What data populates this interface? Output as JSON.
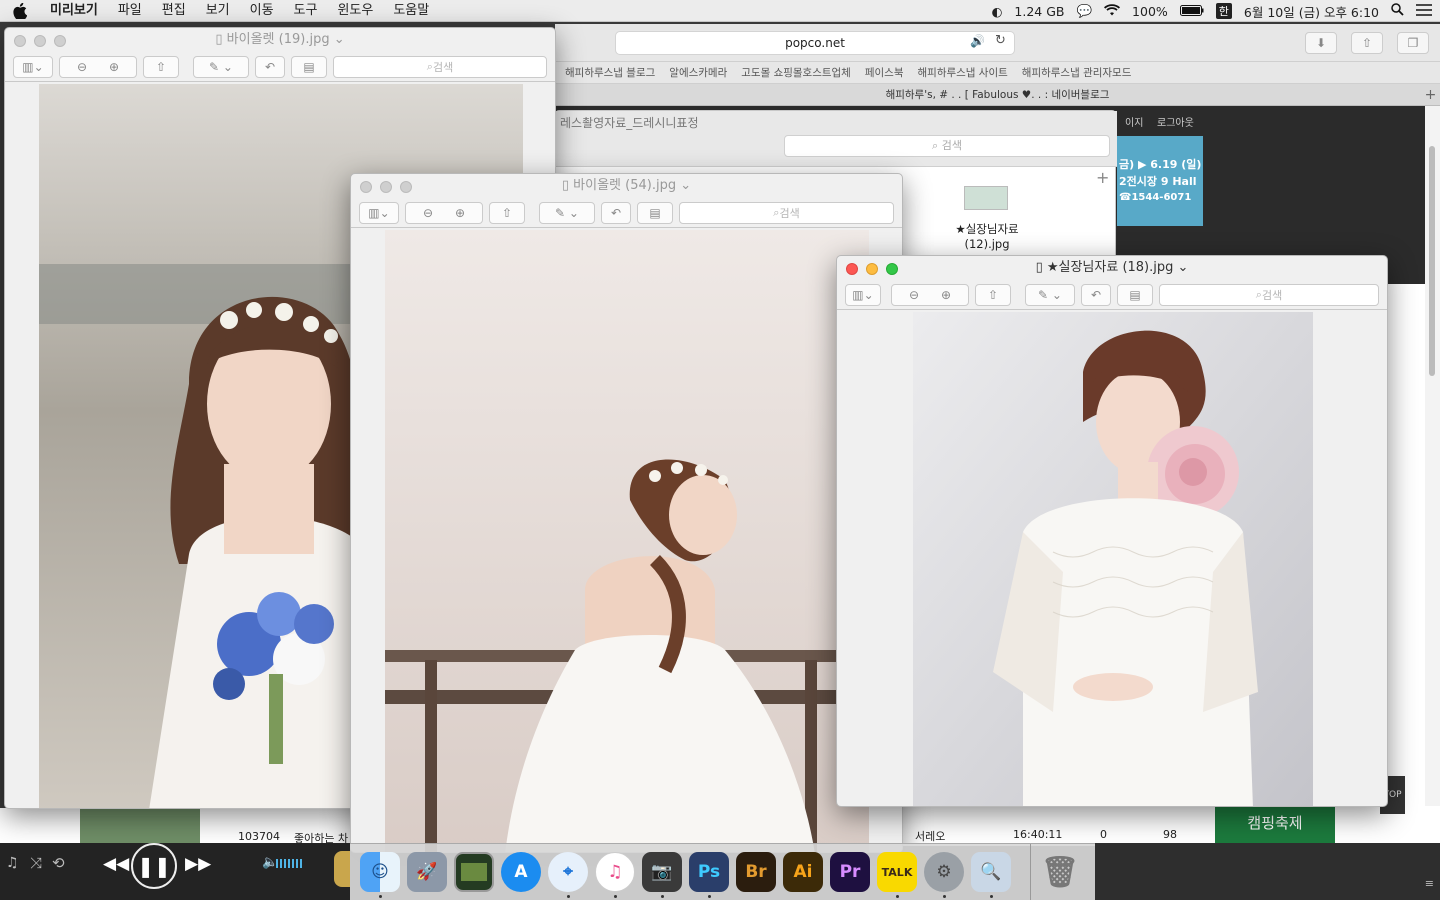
{
  "menubar": {
    "apple": "",
    "items": [
      "미리보기",
      "파일",
      "편집",
      "보기",
      "이동",
      "도구",
      "윈도우",
      "도움말"
    ],
    "status": {
      "memory": "1.24 GB",
      "battery": "100%",
      "input": "한",
      "datetime": "6월 10일 (금) 오후 6:10"
    }
  },
  "safari": {
    "address": "popco.net",
    "favorites": [
      "해피하루스냅 블로그",
      "알에스카메라",
      "고도몰 쇼핑몰호스트업체",
      "페이스북",
      "해피하루스냅 사이트",
      "해피하루스냅 관리자모드"
    ],
    "tab_title": "해피하루's, # . . [ Fabulous ♥. . : 네이버블로그",
    "header_links": [
      "이지",
      "로그아웃"
    ],
    "ad_text": [
      "금) ▶ 6.19 (일)",
      "2전시장 9 Hall",
      "☎1544-6071"
    ],
    "table": {
      "row1": [
        "103704",
        "좋아하는 차"
      ],
      "row2": [
        "서레오",
        "16:40:11",
        "0",
        "98"
      ]
    },
    "green_box": "캠핑축제",
    "top_button": "TOP"
  },
  "finder": {
    "title": "레스촬영자료_드레시니표정",
    "search_placeholder": "검색",
    "file_name": "★실장님자료 (12).jpg"
  },
  "windows": [
    {
      "title": "바이올렛 (19).jpg",
      "search_placeholder": "검색"
    },
    {
      "title": "바이올렛 (54).jpg",
      "search_placeholder": "검색"
    },
    {
      "title": "★실장님자료 (18).jpg",
      "search_placeholder": "검색"
    }
  ],
  "dock": {
    "apps": [
      {
        "name": "Finder",
        "label": ""
      },
      {
        "name": "Launchpad",
        "label": ""
      },
      {
        "name": "Photo Booth",
        "label": ""
      },
      {
        "name": "App Store",
        "label": ""
      },
      {
        "name": "Safari",
        "label": ""
      },
      {
        "name": "iTunes",
        "label": ""
      },
      {
        "name": "Camera",
        "label": ""
      },
      {
        "name": "Photoshop",
        "label": "Ps"
      },
      {
        "name": "Bridge",
        "label": "Br"
      },
      {
        "name": "Illustrator",
        "label": "Ai"
      },
      {
        "name": "Premiere",
        "label": "Pr"
      },
      {
        "name": "KakaoTalk",
        "label": "TALK"
      },
      {
        "name": "System Preferences",
        "label": ""
      },
      {
        "name": "Preview",
        "label": ""
      },
      {
        "name": "Trash",
        "label": ""
      }
    ]
  },
  "colors": {
    "ps": "#2a3e6a",
    "br": "#2b1d0e",
    "ai": "#3c2a08",
    "pr": "#1e1040",
    "kakao": "#f9d900"
  }
}
